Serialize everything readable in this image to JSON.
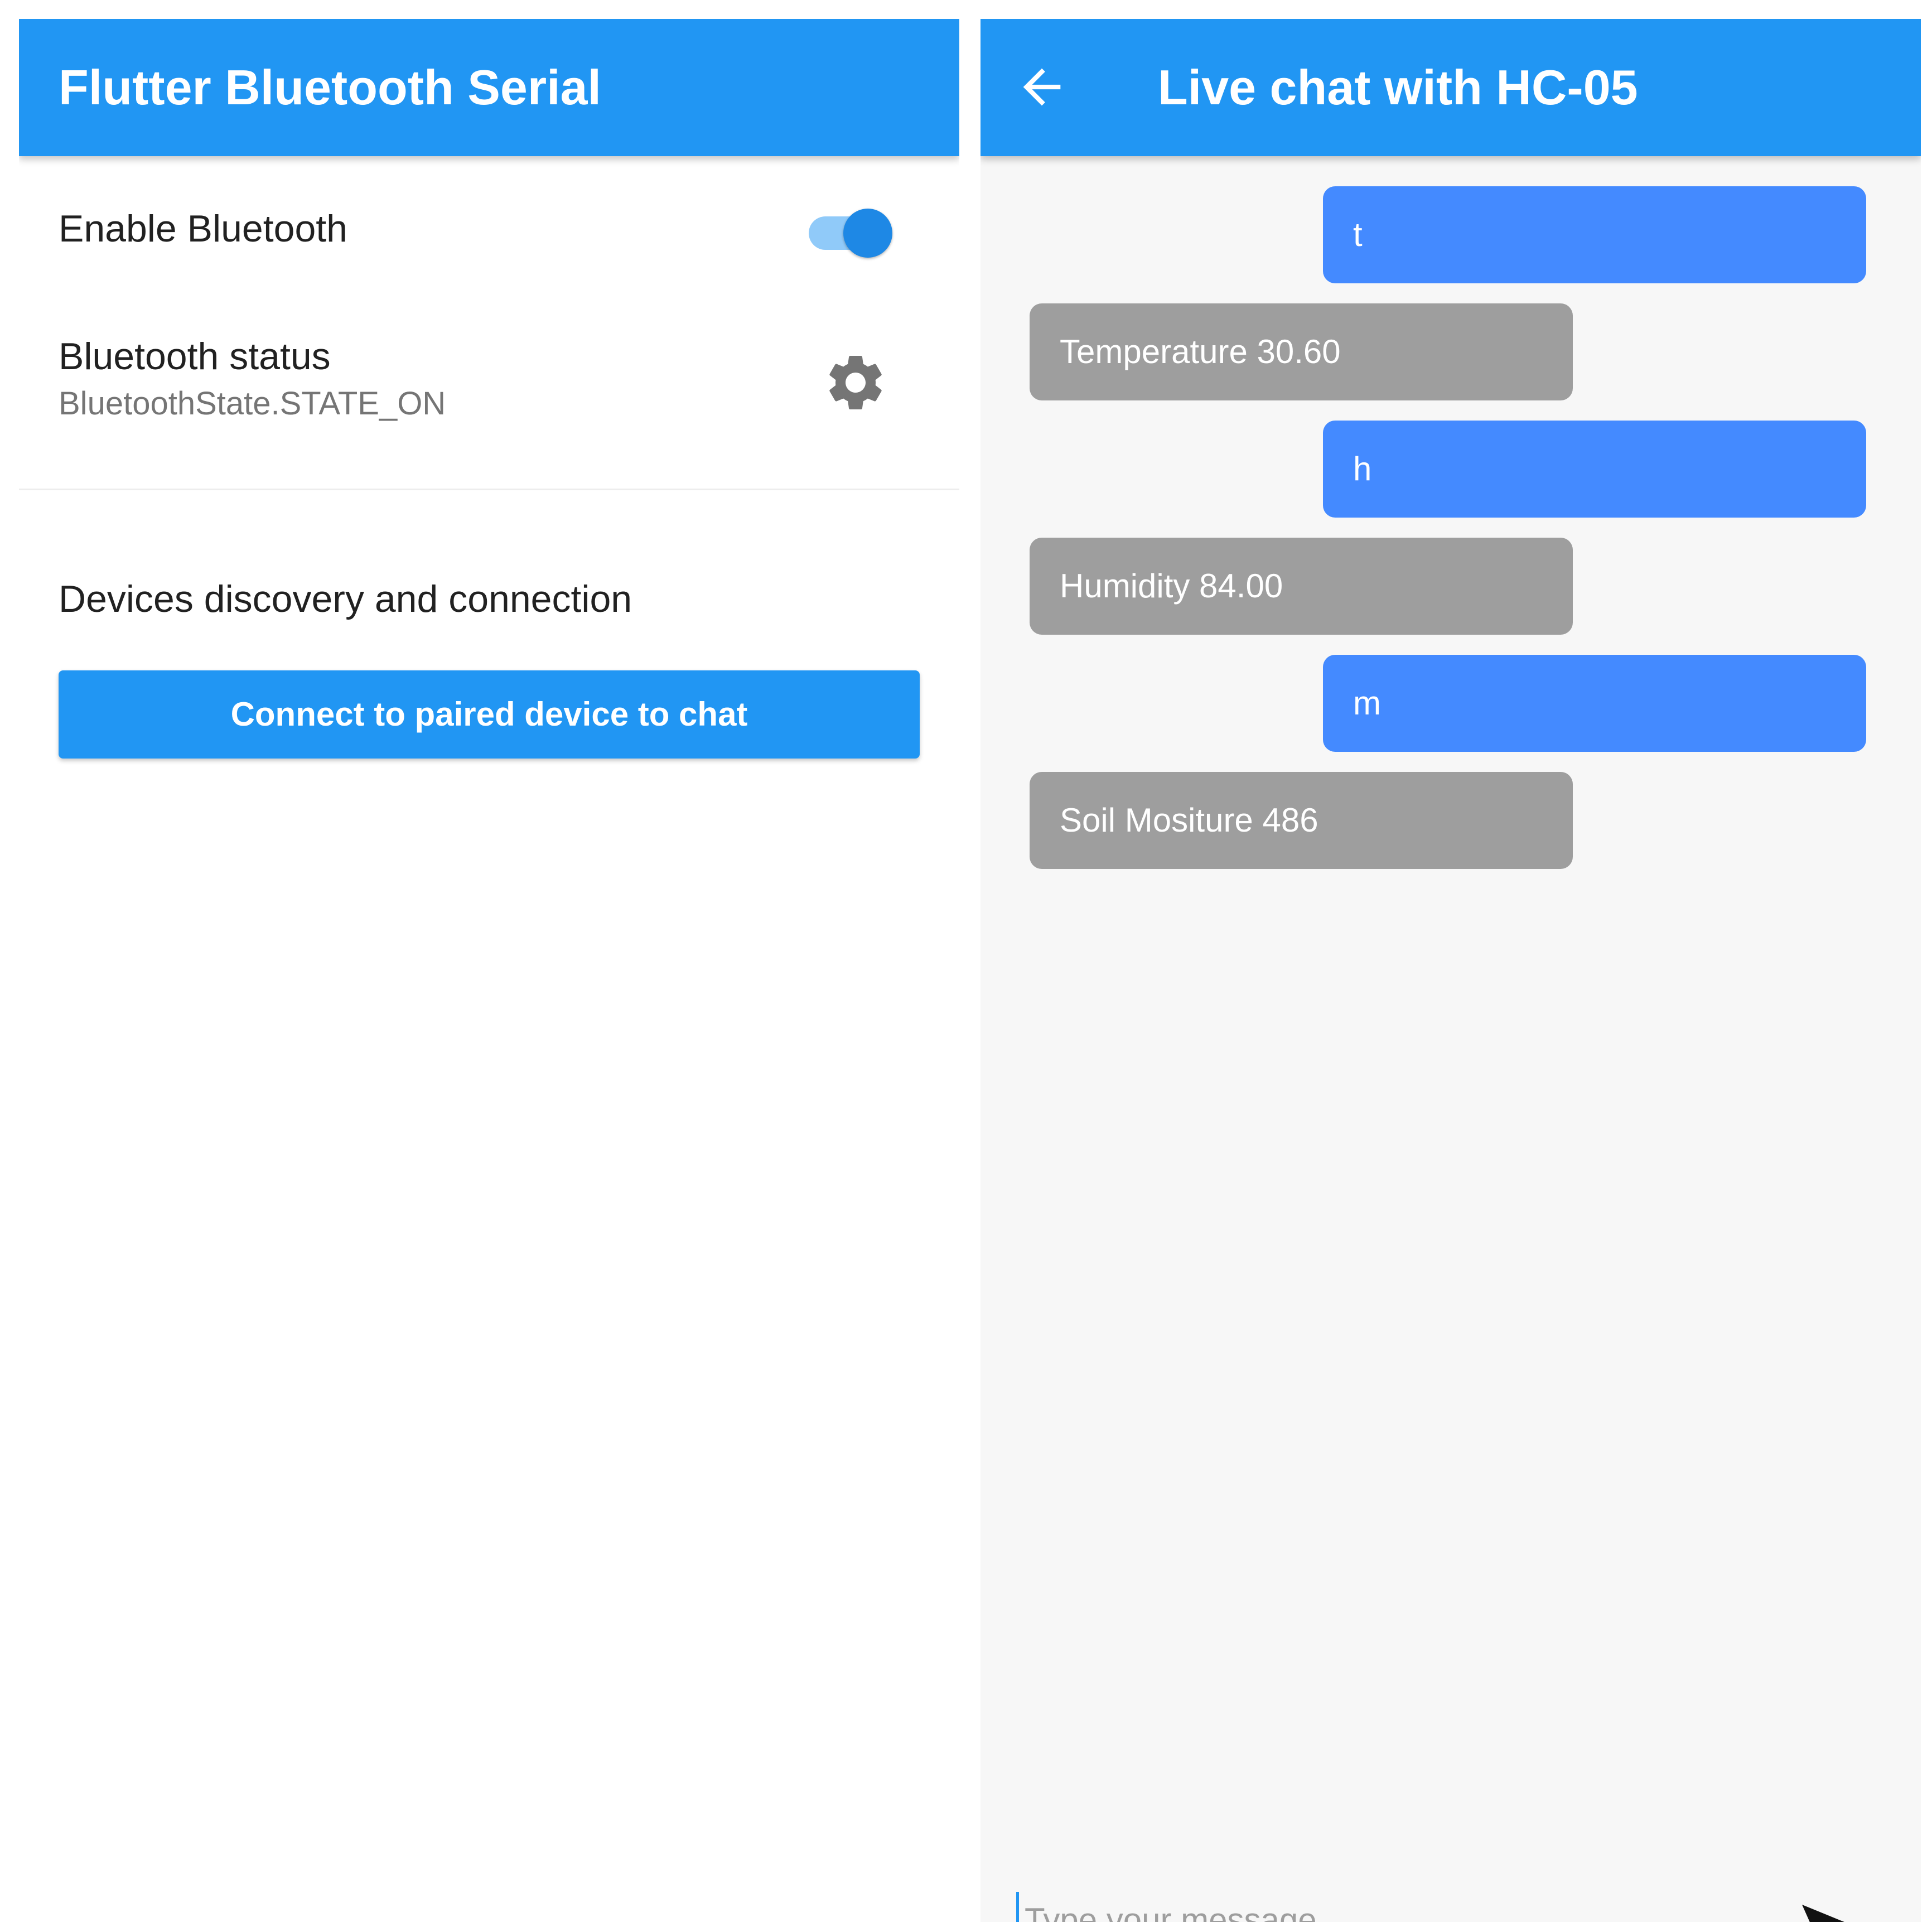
{
  "left": {
    "appbar_title": "Flutter Bluetooth Serial",
    "enable_bluetooth_label": "Enable Bluetooth",
    "bluetooth_enabled": true,
    "status_label": "Bluetooth status",
    "status_value": "BluetoothState.STATE_ON",
    "section_label": "Devices discovery and connection",
    "connect_button_label": "Connect to paired device to chat",
    "settings_icon": "gear-icon"
  },
  "right": {
    "appbar_title": "Live chat with HC-05",
    "back_icon": "arrow-left-icon",
    "messages": [
      {
        "text": "t",
        "sender": "me"
      },
      {
        "text": "Temperature 30.60",
        "sender": "device"
      },
      {
        "text": "h",
        "sender": "me"
      },
      {
        "text": "Humidity 84.00",
        "sender": "device"
      },
      {
        "text": "m",
        "sender": "me"
      },
      {
        "text": "Soil Mositure 486",
        "sender": "device"
      }
    ],
    "input_placeholder": "Type your message...",
    "send_icon": "send-icon"
  },
  "colors": {
    "appbar": "#2196f3",
    "sent_bubble": "#448aff",
    "received_bubble": "#9e9e9e",
    "toggle_track": "#90caf9",
    "toggle_thumb": "#1e88e5"
  }
}
